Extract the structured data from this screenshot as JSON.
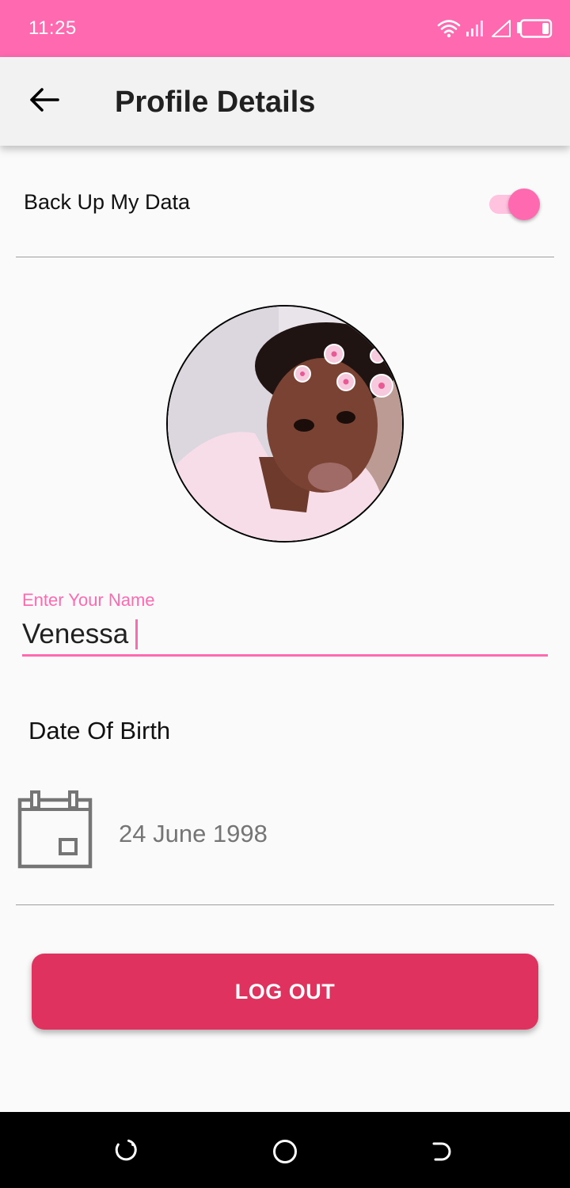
{
  "status_bar": {
    "time": "11:25",
    "icons": [
      "wifi-icon",
      "signal-icon",
      "signal-empty-icon",
      "battery-icon"
    ]
  },
  "app_bar": {
    "back_icon": "arrow-left-icon",
    "title": "Profile Details"
  },
  "backup": {
    "label": "Back Up My Data",
    "enabled": true
  },
  "profile": {
    "avatar_icon": "profile-photo"
  },
  "name_field": {
    "hint": "Enter Your Name",
    "value": "Venessa"
  },
  "dob": {
    "label": "Date Of Birth",
    "calendar_icon": "calendar-icon",
    "value": "24 June 1998"
  },
  "actions": {
    "logout_label": "LOG OUT"
  },
  "nav_bar": {
    "icons": [
      "recents-icon",
      "home-icon",
      "back-icon"
    ]
  },
  "colors": {
    "accent": "#ff69b0",
    "logout_button": "#e0325e",
    "status_bar": "#ff69b0",
    "app_bar": "#f2f2f2"
  }
}
